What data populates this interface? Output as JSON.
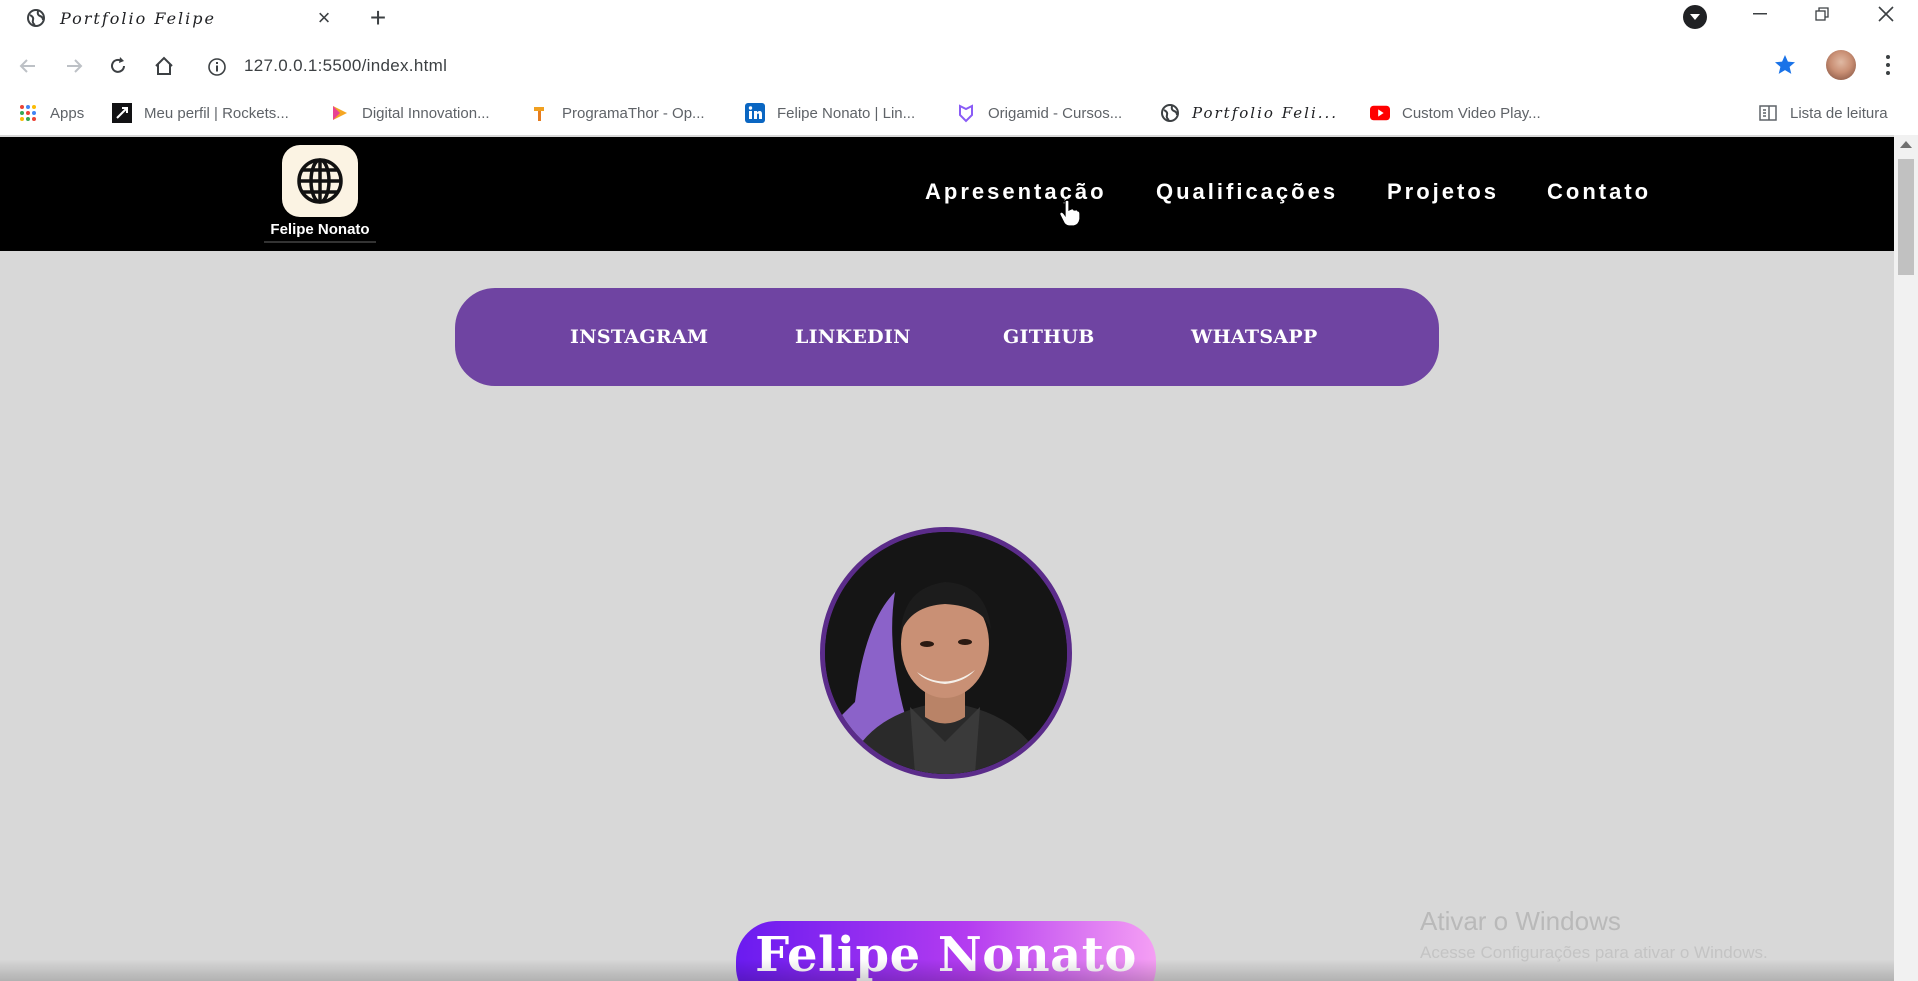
{
  "browser": {
    "tab": {
      "title": "Portfolio Felipe",
      "favicon": "globe-icon"
    },
    "address": "127.0.0.1:5500/index.html",
    "bookmarks": [
      {
        "label": "Apps",
        "icon": "apps-grid-icon"
      },
      {
        "label": "Meu perfil | Rockets...",
        "icon": "rocketseat-icon"
      },
      {
        "label": "Digital Innovation...",
        "icon": "dio-icon"
      },
      {
        "label": "ProgramaThor - Op...",
        "icon": "hammer-icon"
      },
      {
        "label": "Felipe Nonato | Lin...",
        "icon": "linkedin-icon"
      },
      {
        "label": "Origamid - Cursos...",
        "icon": "origamid-icon"
      },
      {
        "label": "Portfolio Feli...",
        "icon": "globe-icon"
      },
      {
        "label": "Custom Video Play...",
        "icon": "youtube-icon"
      }
    ],
    "reading_list": "Lista de leitura"
  },
  "site": {
    "logo_name": "Felipe Nonato",
    "nav": [
      "Apresentação",
      "Qualificações",
      "Projetos",
      "Contato"
    ],
    "social": [
      "INSTAGRAM",
      "LINKEDIN",
      "GITHUB",
      "WHATSAPP"
    ],
    "name_title": "Felipe Nonato"
  },
  "os": {
    "watermark_title": "Ativar o Windows",
    "watermark_sub": "Acesse Configurações para ativar o Windows."
  },
  "colors": {
    "header": "#000000",
    "page_bg": "#d8d8d8",
    "social_bar": "#6f44a2",
    "profile_border": "#5b2c8a",
    "name_gradient": [
      "#6a1bf0",
      "#f59ff4"
    ]
  }
}
